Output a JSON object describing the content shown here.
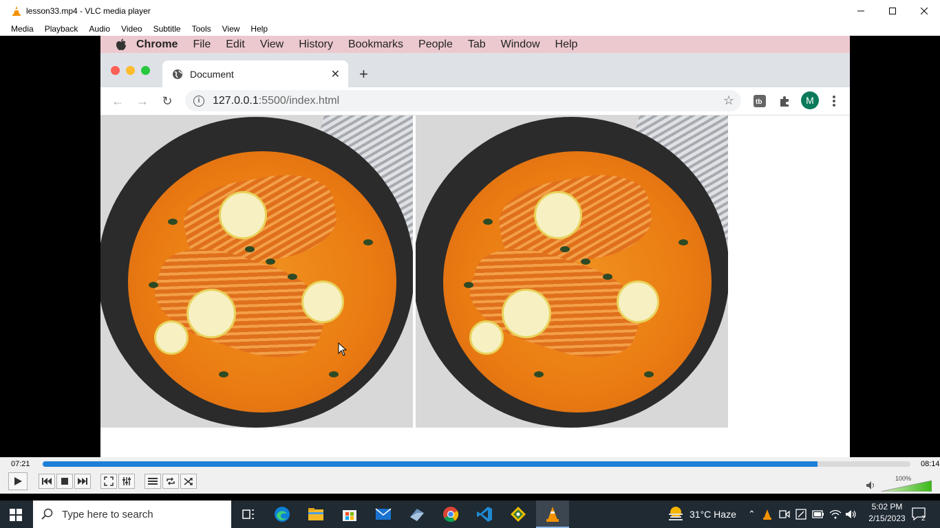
{
  "vlc": {
    "title": "lesson33.mp4 - VLC media player",
    "menu": [
      "Media",
      "Playback",
      "Audio",
      "Video",
      "Subtitle",
      "Tools",
      "View",
      "Help"
    ],
    "elapsed": "07:21",
    "total": "08:14",
    "progress": 0.893,
    "volume_label": "100%",
    "accent_color": "#1e7fd8"
  },
  "mac_menu": {
    "app": "Chrome",
    "items": [
      "File",
      "Edit",
      "View",
      "History",
      "Bookmarks",
      "People",
      "Tab",
      "Window",
      "Help"
    ]
  },
  "chrome": {
    "tab_title": "Document",
    "url_host": "127.0.0.1",
    "url_rest": ":5500/index.html",
    "avatar_letter": "M"
  },
  "taskbar": {
    "search_placeholder": "Type here to search",
    "weather": "31°C  Haze",
    "time": "5:02 PM",
    "date": "2/15/2023",
    "notification_count": "2"
  }
}
